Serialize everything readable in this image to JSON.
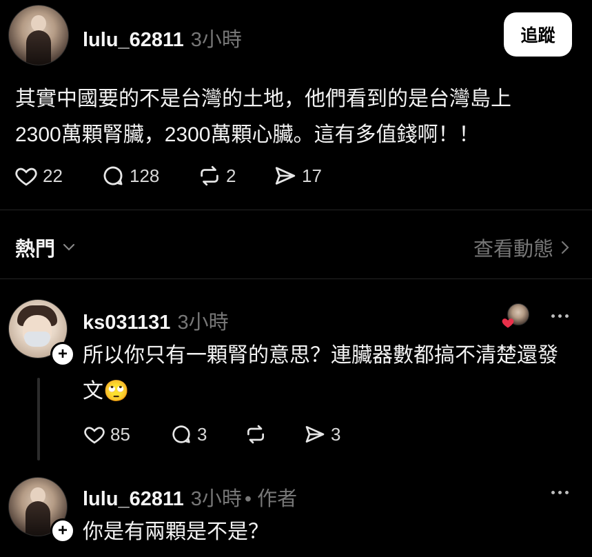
{
  "post": {
    "username": "lulu_62811",
    "time": "3小時",
    "follow_label": "追蹤",
    "text_line1": "其實中國要的不是台灣的土地，他們看到的是台灣島上",
    "text_line2": "2300萬顆腎臟，2300萬顆心臟。這有多值錢啊！！",
    "likes": "22",
    "comments": "128",
    "reposts": "2",
    "shares": "17"
  },
  "sort": {
    "label": "熱門",
    "view_activity": "查看動態"
  },
  "comments": [
    {
      "username": "ks031131",
      "time": "3小時",
      "text_line1": "所以你只有一顆腎的意思？連臟器數都搞不清楚還發",
      "text_line2": "文🙄",
      "likes": "85",
      "comments": "3",
      "shares": "3"
    },
    {
      "username": "lulu_62811",
      "time": "3小時",
      "author_tag": "• 作者",
      "text": "你是有兩顆是不是？"
    }
  ],
  "colors": {
    "background": "#000000",
    "text": "#f3f3f3",
    "muted": "#777777",
    "like_heart": "#e8304a"
  }
}
